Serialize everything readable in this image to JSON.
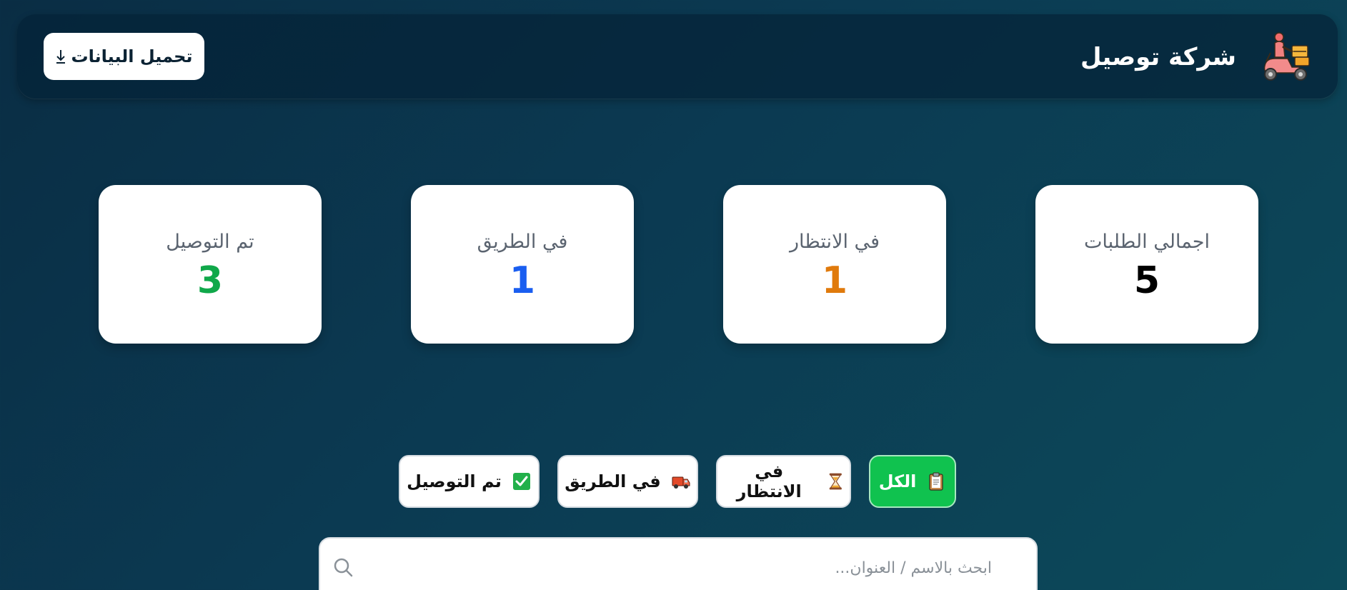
{
  "header": {
    "title": "شركة توصيل",
    "logo_icon": "delivery-scooter-icon",
    "download_label": "تحميل البيانات",
    "download_icon": "download-arrow-icon"
  },
  "stats": [
    {
      "label": "اجمالي الطلبات",
      "value": "5",
      "color": "#000000"
    },
    {
      "label": "في الانتظار",
      "value": "1",
      "color": "#e07a0c"
    },
    {
      "label": "في الطريق",
      "value": "1",
      "color": "#1a5ef0"
    },
    {
      "label": "تم التوصيل",
      "value": "3",
      "color": "#10a84a"
    }
  ],
  "filters": [
    {
      "label": "الكل",
      "icon": "clipboard-icon",
      "active": true
    },
    {
      "label": "في الانتظار",
      "icon": "hourglass-icon",
      "active": false
    },
    {
      "label": "في الطريق",
      "icon": "truck-icon",
      "active": false
    },
    {
      "label": "تم التوصيل",
      "icon": "check-mark-icon",
      "active": false
    }
  ],
  "search": {
    "placeholder": "ابحث بالاسم / العنوان...",
    "value": "",
    "icon": "search-icon"
  },
  "colors": {
    "accent_green": "#10c24f",
    "background": "#0b3a52"
  }
}
